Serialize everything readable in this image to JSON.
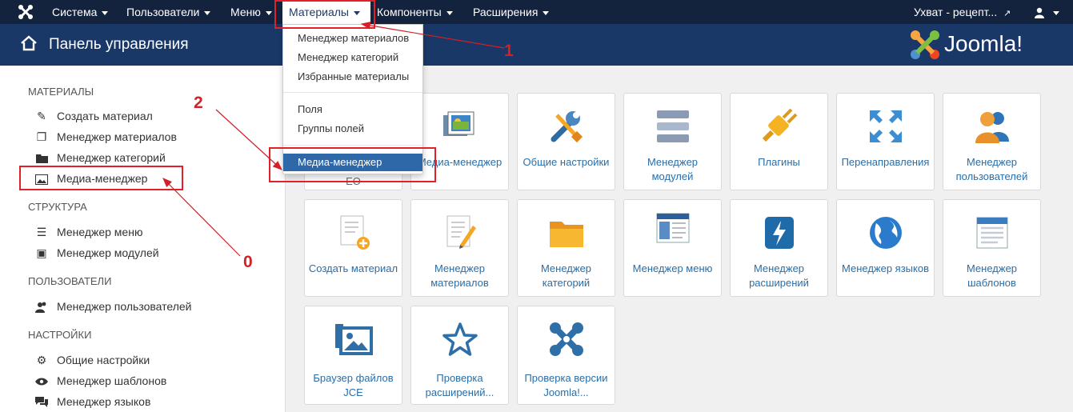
{
  "topbar": {
    "logo_icon": "joomla-icon",
    "items": [
      "Система",
      "Пользователи",
      "Меню",
      "Материалы",
      "Компоненты",
      "Расширения"
    ],
    "site_link": "Ухват - рецепт...",
    "user_icon": "user-icon"
  },
  "header": {
    "title": "Панель управления",
    "brand": "Joomla!",
    "home_icon": "home-icon"
  },
  "dropdown": {
    "group1": [
      "Менеджер материалов",
      "Менеджер категорий",
      "Избранные материалы"
    ],
    "group2": [
      "Поля",
      "Группы полей"
    ],
    "highlighted": "Медиа-менеджер"
  },
  "sidebar": {
    "sections": [
      {
        "title": "МАТЕРИАЛЫ",
        "items": [
          {
            "label": "Создать материал",
            "icon": "pencil-icon"
          },
          {
            "label": "Менеджер материалов",
            "icon": "copy-icon"
          },
          {
            "label": "Менеджер категорий",
            "icon": "folder-icon"
          },
          {
            "label": "Медиа-менеджер",
            "icon": "image-icon"
          }
        ]
      },
      {
        "title": "СТРУКТУРА",
        "items": [
          {
            "label": "Менеджер меню",
            "icon": "list-icon"
          },
          {
            "label": "Менеджер модулей",
            "icon": "cube-icon"
          }
        ]
      },
      {
        "title": "ПОЛЬЗОВАТЕЛИ",
        "items": [
          {
            "label": "Менеджер пользователей",
            "icon": "users-icon"
          }
        ]
      },
      {
        "title": "НАСТРОЙКИ",
        "items": [
          {
            "label": "Общие настройки",
            "icon": "cog-icon"
          },
          {
            "label": "Менеджер шаблонов",
            "icon": "eye-icon"
          },
          {
            "label": "Менеджер языков",
            "icon": "comments-icon"
          }
        ]
      }
    ]
  },
  "tiles": {
    "row1": [
      {
        "label": "Медиа-менеджер",
        "icon": "media-icon"
      },
      {
        "label": "Общие настройки",
        "icon": "tools-icon"
      },
      {
        "label": "Менеджер модулей",
        "icon": "modules-icon"
      },
      {
        "label": "Плагины",
        "icon": "plug-icon"
      },
      {
        "label": "Перенаправления",
        "icon": "arrows-icon"
      },
      {
        "label": "Менеджер пользователей",
        "icon": "users-icon"
      }
    ],
    "row1_hidden_fragment": "ЕО",
    "row2": [
      {
        "label": "Создать материал",
        "icon": "add-doc-icon"
      },
      {
        "label": "Менеджер материалов",
        "icon": "edit-doc-icon"
      },
      {
        "label": "Менеджер категорий",
        "icon": "folder-icon"
      },
      {
        "label": "Менеджер меню",
        "icon": "menu-icon"
      },
      {
        "label": "Менеджер расширений",
        "icon": "flash-icon"
      },
      {
        "label": "Менеджер языков",
        "icon": "globe-icon"
      },
      {
        "label": "Менеджер шаблонов",
        "icon": "template-icon"
      }
    ],
    "row3": [
      {
        "label": "Браузер файлов JCE",
        "icon": "picture-icon"
      },
      {
        "label": "Проверка расширений...",
        "icon": "star-icon"
      },
      {
        "label": "Проверка версии Joomla!...",
        "icon": "joomla-icon"
      }
    ]
  },
  "annotations": [
    "1",
    "2",
    "0"
  ],
  "colors": {
    "topbar": "#14233d",
    "header": "#1a3867",
    "highlight": "#2f68a8",
    "annotation": "#d42027",
    "link": "#2a6ea8"
  }
}
